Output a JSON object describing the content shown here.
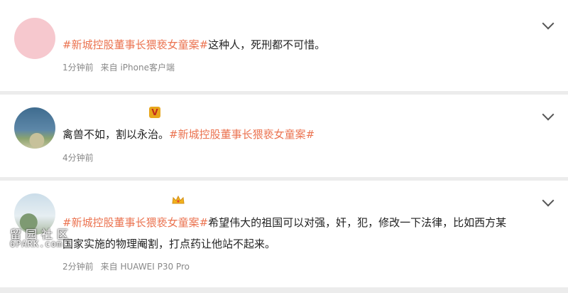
{
  "comments": [
    {
      "hashtag": "#新城控股董事长猥亵女童案#",
      "text": "这种人，死刑都不可惜。",
      "time": "1分钟前",
      "source": "来自 iPhone客户端"
    },
    {
      "text_before": "禽兽不如，割以永治。",
      "hashtag": "#新城控股董事长猥亵女童案#",
      "time": "4分钟前",
      "badge": "V"
    },
    {
      "hashtag": "#新城控股董事长猥亵女童案#",
      "text_line1": "希望伟大的祖国可以对强，奸，犯，修改一下法律，比如西方某",
      "text_line2": "国家实施的物理阉割，打点药让他站不起来。",
      "time": "2分钟前",
      "source": "来自 HUAWEI P30 Pro"
    }
  ],
  "watermark": {
    "cn": "留园社区",
    "en": "6PARK.com"
  },
  "colors": {
    "hashtag": "#eb7350",
    "hash_mark": "#6f9dd0",
    "meta": "#888888"
  }
}
